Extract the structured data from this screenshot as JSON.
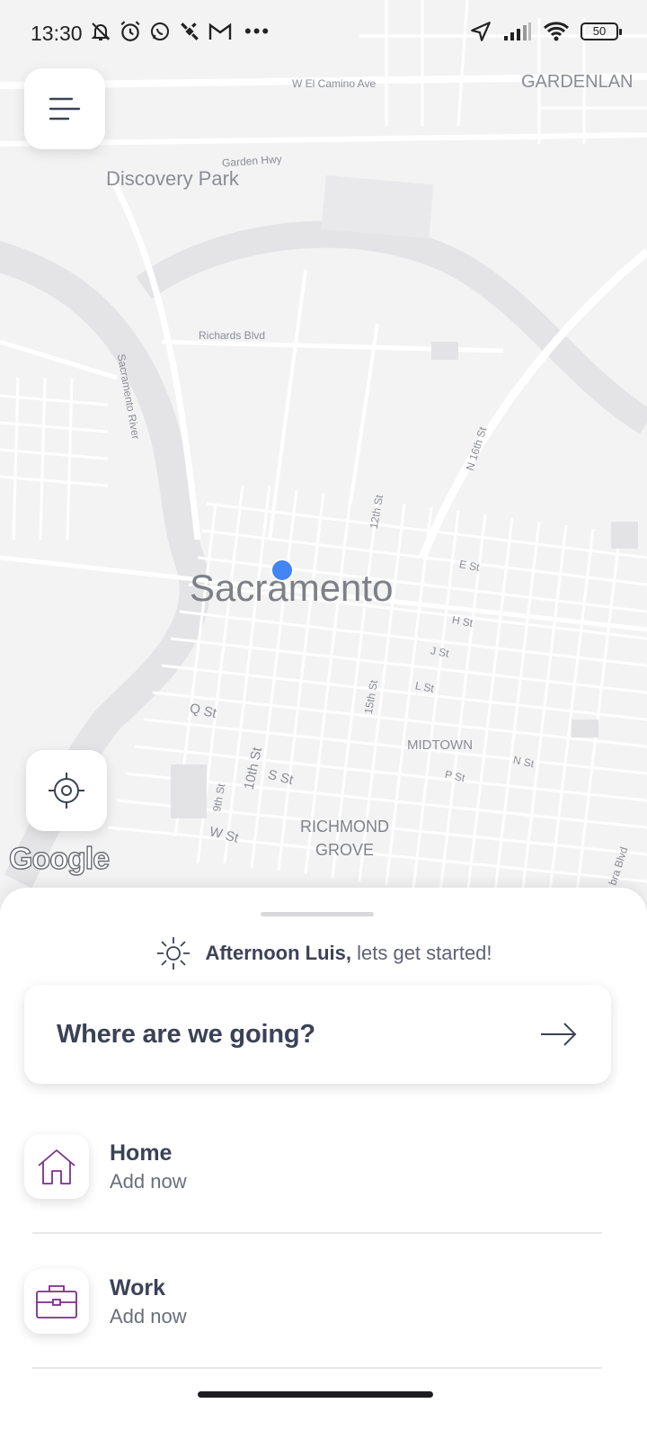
{
  "status_bar": {
    "time": "13:30",
    "left_icons": [
      "bell-off-icon",
      "alarm-icon",
      "whatsapp-icon",
      "satellite-icon",
      "gmail-icon",
      "more-dots-icon"
    ],
    "right_icons": [
      "location-arrow-icon",
      "signal-icon",
      "wifi-icon"
    ],
    "battery_level": "50"
  },
  "map": {
    "city_label": "Sacramento",
    "labels": {
      "w_el_camino": "W El Camino Ave",
      "gardenland": "GARDENLAN",
      "garden_hwy": "Garden Hwy",
      "discovery_park": "Discovery Park",
      "richards_blvd": "Richards Blvd",
      "sacramento_river": "Sacramento River",
      "n16th": "N 16th St",
      "12th": "12th St",
      "e_st": "E St",
      "h_st": "H St",
      "j_st": "J St",
      "l_st": "L St",
      "15th": "15th St",
      "q_st": "Q St",
      "midtown": "MIDTOWN",
      "n_st": "N St",
      "p_st": "P St",
      "10th": "10th St",
      "s_st": "S St",
      "9th": "9th St",
      "w_st": "W St",
      "richmond": "RICHMOND",
      "grove": "GROVE",
      "bra_blvd": "bra Blvd"
    },
    "attribution": "Google",
    "current_location_color": "#4285f4"
  },
  "sheet": {
    "greeting_name": "Afternoon Luis,",
    "greeting_rest": " lets get started!",
    "search_label": "Where are we going?",
    "places": [
      {
        "title": "Home",
        "subtitle": "Add now",
        "icon": "home-icon"
      },
      {
        "title": "Work",
        "subtitle": "Add now",
        "icon": "briefcase-icon"
      }
    ]
  },
  "colors": {
    "accent_purple": "#7a2f8c",
    "text_dark": "#3b4256"
  }
}
